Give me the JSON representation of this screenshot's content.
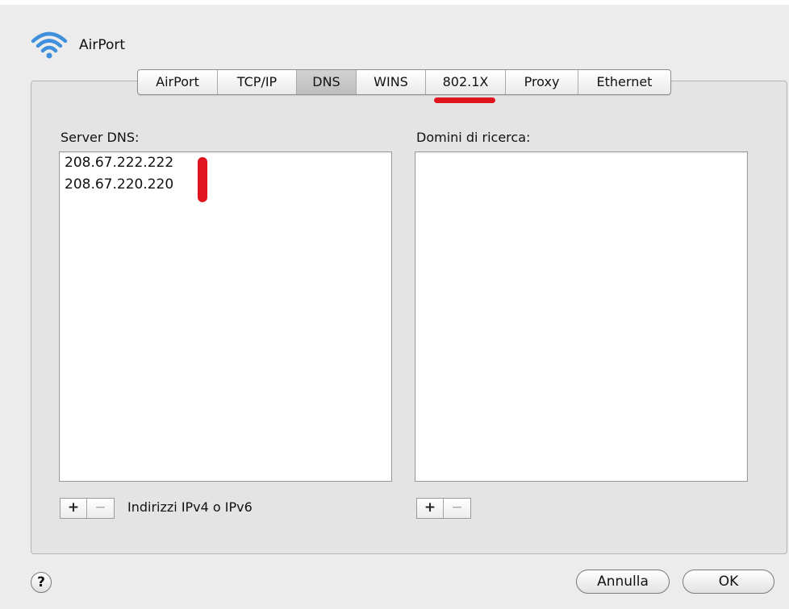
{
  "header": {
    "title": "AirPort",
    "icon": "wifi-icon"
  },
  "tabs": [
    {
      "label": "AirPort"
    },
    {
      "label": "TCP/IP"
    },
    {
      "label": "DNS",
      "selected": true
    },
    {
      "label": "WINS"
    },
    {
      "label": "802.1X"
    },
    {
      "label": "Proxy"
    },
    {
      "label": "Ethernet"
    }
  ],
  "dns": {
    "label": "Server DNS:",
    "servers": [
      "208.67.222.222",
      "208.67.220.220"
    ],
    "hint": "Indirizzi IPv4 o IPv6"
  },
  "search_domains": {
    "label": "Domini di ricerca:",
    "items": []
  },
  "controls": {
    "add": "+",
    "remove": "−"
  },
  "buttons": {
    "help": "?",
    "cancel": "Annulla",
    "ok": "OK"
  },
  "colors": {
    "annotation_red": "#e0141e",
    "wifi_blue": "#3f8fdc"
  }
}
